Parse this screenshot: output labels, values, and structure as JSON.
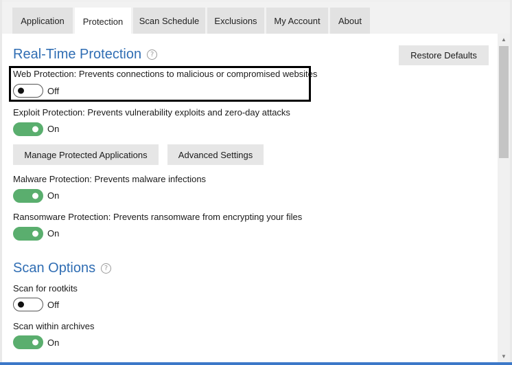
{
  "tabs": [
    {
      "label": "Application",
      "active": false
    },
    {
      "label": "Protection",
      "active": true
    },
    {
      "label": "Scan Schedule",
      "active": false
    },
    {
      "label": "Exclusions",
      "active": false
    },
    {
      "label": "My Account",
      "active": false
    },
    {
      "label": "About",
      "active": false
    }
  ],
  "realtime": {
    "title": "Real-Time Protection",
    "help_icon": "?",
    "restore_label": "Restore Defaults",
    "web": {
      "label": "Web Protection: Prevents connections to malicious or compromised websites",
      "state": "Off"
    },
    "exploit": {
      "label": "Exploit Protection: Prevents vulnerability exploits and zero-day attacks",
      "state": "On"
    },
    "manage_label": "Manage Protected Applications",
    "advanced_label": "Advanced Settings",
    "malware": {
      "label": "Malware Protection: Prevents malware infections",
      "state": "On"
    },
    "ransomware": {
      "label": "Ransomware Protection: Prevents ransomware from encrypting your files",
      "state": "On"
    }
  },
  "scan": {
    "title": "Scan Options",
    "help_icon": "?",
    "rootkits": {
      "label": "Scan for rootkits",
      "state": "Off"
    },
    "archives": {
      "label": "Scan within archives",
      "state": "On"
    }
  },
  "colors": {
    "accent": "#2f6db3",
    "toggle_on": "#5aae6e"
  },
  "icons": {
    "scroll_up": "chevron-up-icon",
    "scroll_down": "chevron-down-icon"
  }
}
